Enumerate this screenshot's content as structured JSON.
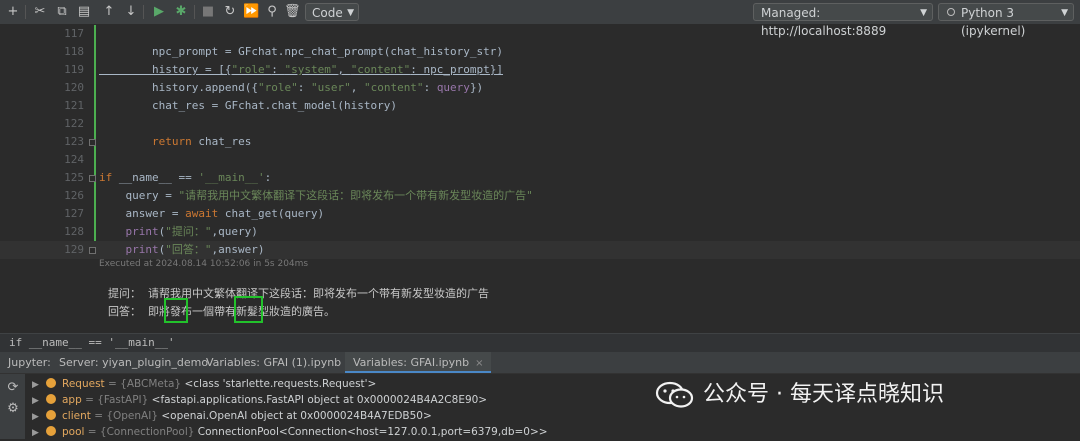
{
  "toolbar": {
    "cell_type": "Code",
    "server": "Managed: http://localhost:8889",
    "kernel": "Python 3 (ipykernel)"
  },
  "code_lines": [
    {
      "num": "117",
      "segments": []
    },
    {
      "num": "118",
      "segments": [
        {
          "t": "        npc_prompt = GFchat.npc_chat_prompt(chat_history_str)",
          "c": ""
        }
      ]
    },
    {
      "num": "119",
      "segments": [
        {
          "t": "        history = [{",
          "c": "underline"
        },
        {
          "t": "\"role\"",
          "c": "str underline"
        },
        {
          "t": ": ",
          "c": "underline"
        },
        {
          "t": "\"system\"",
          "c": "str underline"
        },
        {
          "t": ", ",
          "c": "underline"
        },
        {
          "t": "\"content\"",
          "c": "str underline"
        },
        {
          "t": ": npc_prompt}]",
          "c": "underline"
        }
      ]
    },
    {
      "num": "120",
      "segments": [
        {
          "t": "        history.append({",
          "c": ""
        },
        {
          "t": "\"role\"",
          "c": "str"
        },
        {
          "t": ": ",
          "c": ""
        },
        {
          "t": "\"user\"",
          "c": "str"
        },
        {
          "t": ", ",
          "c": ""
        },
        {
          "t": "\"content\"",
          "c": "str"
        },
        {
          "t": ": ",
          "c": ""
        },
        {
          "t": "query",
          "c": "param"
        },
        {
          "t": "})",
          "c": ""
        }
      ]
    },
    {
      "num": "121",
      "segments": [
        {
          "t": "        chat_res = GFchat.chat_model(history)",
          "c": ""
        }
      ]
    },
    {
      "num": "122",
      "segments": []
    },
    {
      "num": "123",
      "segments": [
        {
          "t": "        ",
          "c": ""
        },
        {
          "t": "return",
          "c": "kw"
        },
        {
          "t": " chat_res",
          "c": ""
        }
      ]
    },
    {
      "num": "124",
      "segments": []
    },
    {
      "num": "125",
      "segments": [
        {
          "t": "if",
          "c": "kw"
        },
        {
          "t": " __name__ == ",
          "c": ""
        },
        {
          "t": "'__main__'",
          "c": "str"
        },
        {
          "t": ":",
          "c": ""
        }
      ]
    },
    {
      "num": "126",
      "segments": [
        {
          "t": "    query = ",
          "c": ""
        },
        {
          "t": "\"请帮我用中文繁体翻译下这段话：即将发布一个带有新发型妆造的广告\"",
          "c": "str"
        }
      ]
    },
    {
      "num": "127",
      "segments": [
        {
          "t": "    answer = ",
          "c": ""
        },
        {
          "t": "await",
          "c": "kw"
        },
        {
          "t": " chat_get(query)",
          "c": ""
        }
      ]
    },
    {
      "num": "128",
      "segments": [
        {
          "t": "    ",
          "c": ""
        },
        {
          "t": "print",
          "c": "param"
        },
        {
          "t": "(",
          "c": ""
        },
        {
          "t": "\"提问：\"",
          "c": "str"
        },
        {
          "t": ",query)",
          "c": ""
        }
      ]
    },
    {
      "num": "129",
      "segments": [
        {
          "t": "    ",
          "c": ""
        },
        {
          "t": "print",
          "c": "param"
        },
        {
          "t": "(",
          "c": ""
        },
        {
          "t": "\"回答：\"",
          "c": "str"
        },
        {
          "t": ",answer)",
          "c": ""
        }
      ]
    }
  ],
  "exec_info": "Executed at 2024.08.14 10:52:06 in 5s 204ms",
  "output": {
    "line1": "提问：  请帮我用中文繁体翻译下这段话：即将发布一个带有新发型妆造的广告",
    "line2": "回答：  即將發布一個帶有新髮型妝造的廣告。"
  },
  "breadcrumb": "if __name__ == '__main__'",
  "tabs": {
    "label": "Jupyter:",
    "items": [
      {
        "label": "Server: yiyan_plugin_demo",
        "closable": false
      },
      {
        "label": "Variables: GFAI (1).ipynb",
        "closable": true
      },
      {
        "label": "Variables: GFAI.ipynb",
        "closable": true
      }
    ],
    "close_glyph": "×"
  },
  "variables": [
    {
      "name": "Request",
      "type": "= {ABCMeta}",
      "value": "<class 'starlette.requests.Request'>"
    },
    {
      "name": "app",
      "type": "= {FastAPI}",
      "value": "<fastapi.applications.FastAPI object at 0x0000024B4A2C8E90>"
    },
    {
      "name": "client",
      "type": "= {OpenAI}",
      "value": "<openai.OpenAI object at 0x0000024B4A7EDB50>"
    },
    {
      "name": "pool",
      "type": "= {ConnectionPool}",
      "value": "ConnectionPool<Connection<host=127.0.0.1,port=6379,db=0>>"
    }
  ],
  "watermark": "公众号 · 每天译点晓知识",
  "colors": {
    "accent": "#4caf50",
    "highlight": "#22c22b",
    "tab_active": "#4a88c7"
  }
}
